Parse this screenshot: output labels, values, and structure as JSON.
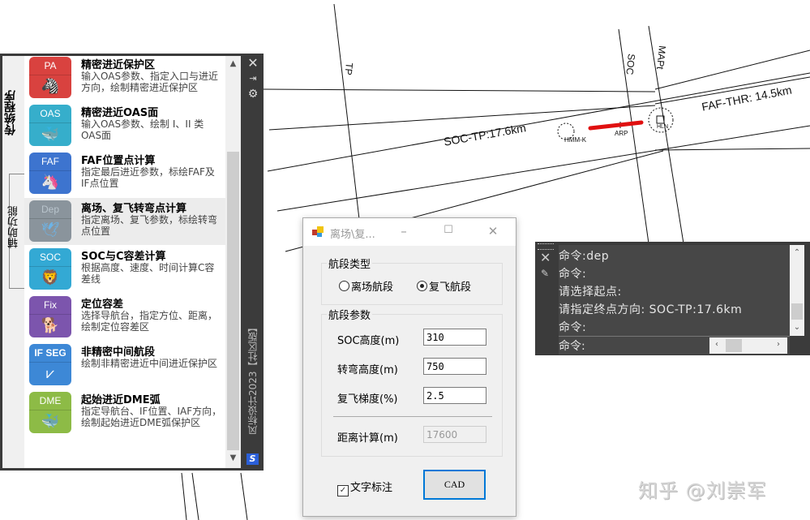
{
  "drawing": {
    "labels": {
      "tp": "TP",
      "soc": "SOC",
      "mapt": "MAPt",
      "soc_tp": "SOC-TP:17.6km",
      "faf_thr": "FAF-THR: 14.5km",
      "arp": "ARP",
      "navaid_left": "HMM-K",
      "navaid_right": "HLN"
    },
    "runway_color": "#e01010"
  },
  "palette": {
    "tabs": [
      {
        "label": "传统程序",
        "active": true
      },
      {
        "label": "辅助功能",
        "active": false
      }
    ],
    "tools": [
      {
        "code": "PA",
        "glyph": "🦓",
        "color": "#d9423f",
        "title": "精密进近保护区",
        "desc": "输入OAS参数、指定入口与进近方向，绘制精密进近保护区"
      },
      {
        "code": "OAS",
        "glyph": "🐳",
        "color": "#36aecb",
        "title": "精密进近OAS面",
        "desc": "输入OAS参数、绘制 I、II 类OAS面"
      },
      {
        "code": "FAF",
        "glyph": "🦄",
        "color": "#3d74cf",
        "title": "FAF位置点计算",
        "desc": "指定最后进近参数，标绘FAF及IF点位置"
      },
      {
        "code": "Dep",
        "glyph": "🕊",
        "color": "#8a949c",
        "title": "离场、复飞转弯点计算",
        "desc": "指定离场、复飞参数，标绘转弯点位置",
        "selected": true
      },
      {
        "code": "SOC",
        "glyph": "🦁",
        "color": "#33a9d4",
        "title": "SOC与C容差计算",
        "desc": "根据高度、速度、时间计算C容差线"
      },
      {
        "code": "Fix",
        "glyph": "🐕",
        "color": "#7c55ad",
        "title": "定位容差",
        "desc": "选择导航台，指定方位、距离，绘制定位容差区"
      },
      {
        "code": "IF SEG",
        "glyph": "⩗",
        "color": "#3d88d6",
        "title": "非精密中间航段",
        "desc": "绘制非精密进近中间进近保护区"
      },
      {
        "code": "DME",
        "glyph": "🐳",
        "color": "#8dbb46",
        "title": "起始进近DME弧",
        "desc": "指定导航台、IF位置、IAF方向，绘制起始进近DME弧保护区"
      }
    ],
    "caption": "风标设计2023【社区版】",
    "logo": "S"
  },
  "dialog": {
    "title": "离场\\复...",
    "group_type": {
      "label": "航段类型",
      "options": [
        {
          "label": "离场航段",
          "checked": false
        },
        {
          "label": "复飞航段",
          "checked": true
        }
      ]
    },
    "group_params": {
      "label": "航段参数",
      "fields": [
        {
          "label": "SOC高度(m)",
          "value": "310"
        },
        {
          "label": "转弯高度(m)",
          "value": "750"
        },
        {
          "label": "复飞梯度(%)",
          "value": "2.5"
        }
      ],
      "result": {
        "label": "距离计算(m)",
        "value": "17600"
      }
    },
    "annotate": {
      "label": "文字标注",
      "checked": true
    },
    "cad_button": "CAD"
  },
  "command": {
    "history": [
      "命令:dep",
      "命令:",
      "请选择起点:",
      "请指定终点方向: SOC-TP:17.6km",
      "命令:"
    ],
    "prompt": "命令:"
  },
  "watermark": "知乎 @刘崇军"
}
